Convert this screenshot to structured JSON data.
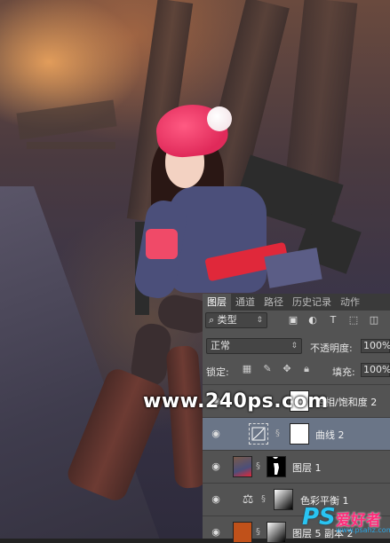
{
  "watermark": "www.240ps.com",
  "layers_panel": {
    "tabs": [
      "图层",
      "通道",
      "路径",
      "历史记录",
      "动作"
    ],
    "active_tab": "图层",
    "filter_kind": "类型",
    "blend_mode": "正常",
    "opacity_label": "不透明度:",
    "opacity_value": "100%",
    "lock_label": "锁定:",
    "fill_label": "填充:",
    "fill_value": "100%",
    "layers": [
      {
        "name": "色相/饱和度 2",
        "selected": false
      },
      {
        "name": "曲线 2",
        "selected": true
      },
      {
        "name": "图层 1",
        "selected": false
      },
      {
        "name": "色彩平衡 1",
        "selected": false
      },
      {
        "name": "图层 5 副本 2",
        "selected": false
      }
    ]
  },
  "logo": {
    "ps_text": "PS",
    "cn_text": "爱好者",
    "url": "www.psahz.com"
  },
  "colors": {
    "panel_bg": "#535353",
    "selected_layer": "#6a7587",
    "logo_ps": "#29c4f2",
    "logo_cn": "#ff2b7a"
  }
}
